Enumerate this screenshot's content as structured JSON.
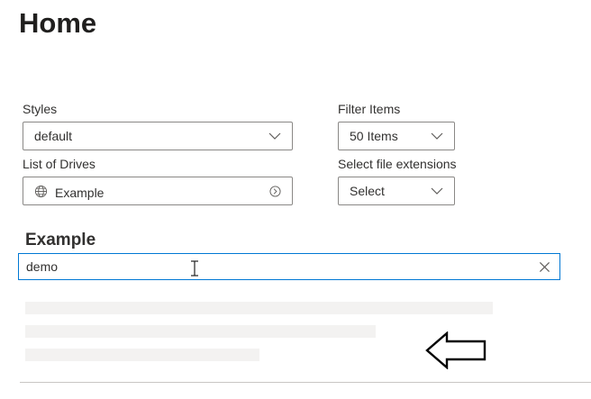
{
  "page": {
    "title": "Home"
  },
  "filters": {
    "styles": {
      "label": "Styles",
      "selected": "default"
    },
    "filter_items": {
      "label": "Filter Items",
      "selected": "50 Items"
    },
    "drives": {
      "label": "List of Drives",
      "selected": "Example",
      "icon": "globe-icon"
    },
    "file_extensions": {
      "label": "Select file extensions",
      "selected": "Select"
    }
  },
  "section": {
    "heading": "Example"
  },
  "search": {
    "value": "demo",
    "clear_icon": "close-icon"
  },
  "colors": {
    "focus_border": "#0078d4",
    "shimmer": "#f3f2f1",
    "input_border": "#8a8886"
  }
}
